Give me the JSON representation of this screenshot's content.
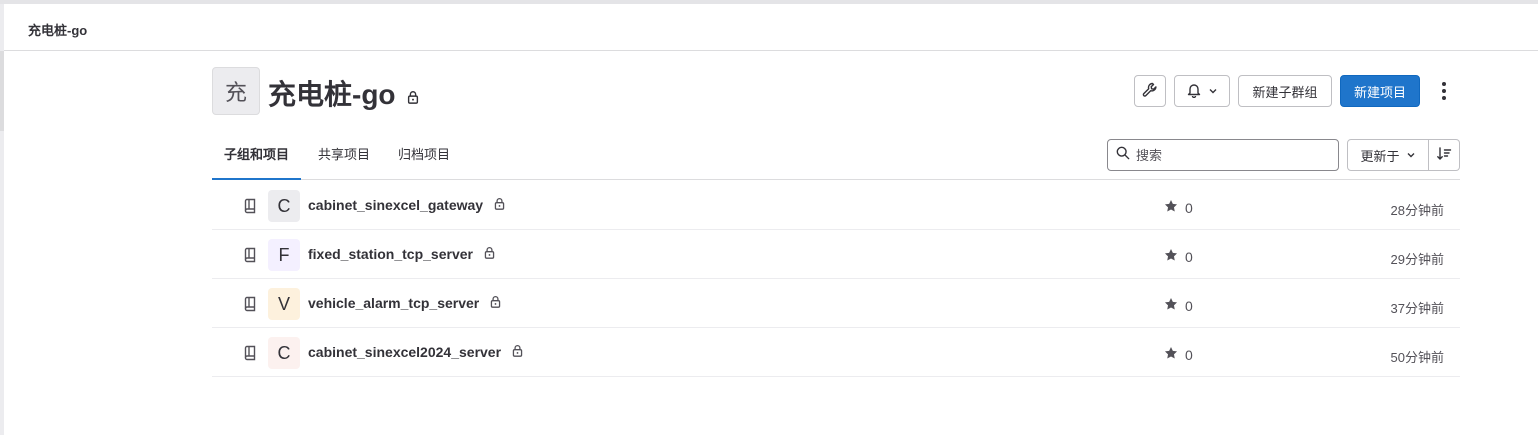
{
  "breadcrumb": {
    "text": "充电桩-go"
  },
  "group": {
    "avatar_letter": "充",
    "title": "充电桩-go",
    "visibility": "private"
  },
  "actions": {
    "wrench_icon": "wrench-icon",
    "bell_icon": "bell-icon",
    "new_subgroup": "新建子群组",
    "new_project": "新建项目"
  },
  "tabs": [
    {
      "label": "子组和项目",
      "active": true
    },
    {
      "label": "共享项目",
      "active": false
    },
    {
      "label": "归档项目",
      "active": false
    }
  ],
  "search": {
    "placeholder": "搜索",
    "value": ""
  },
  "sort": {
    "label": "更新于"
  },
  "colors": {
    "primary": "#1f75cb",
    "avatar_c1": "#ececef",
    "avatar_f": "#f4f0ff",
    "avatar_v": "#fdf1dd",
    "avatar_c2": "#fcf1ef"
  },
  "projects": [
    {
      "letter": "C",
      "name": "cabinet_sinexcel_gateway",
      "stars": "0",
      "updated": "28分钟前"
    },
    {
      "letter": "F",
      "name": "fixed_station_tcp_server",
      "stars": "0",
      "updated": "29分钟前"
    },
    {
      "letter": "V",
      "name": "vehicle_alarm_tcp_server",
      "stars": "0",
      "updated": "37分钟前"
    },
    {
      "letter": "C",
      "name": "cabinet_sinexcel2024_server",
      "stars": "0",
      "updated": "50分钟前"
    }
  ]
}
